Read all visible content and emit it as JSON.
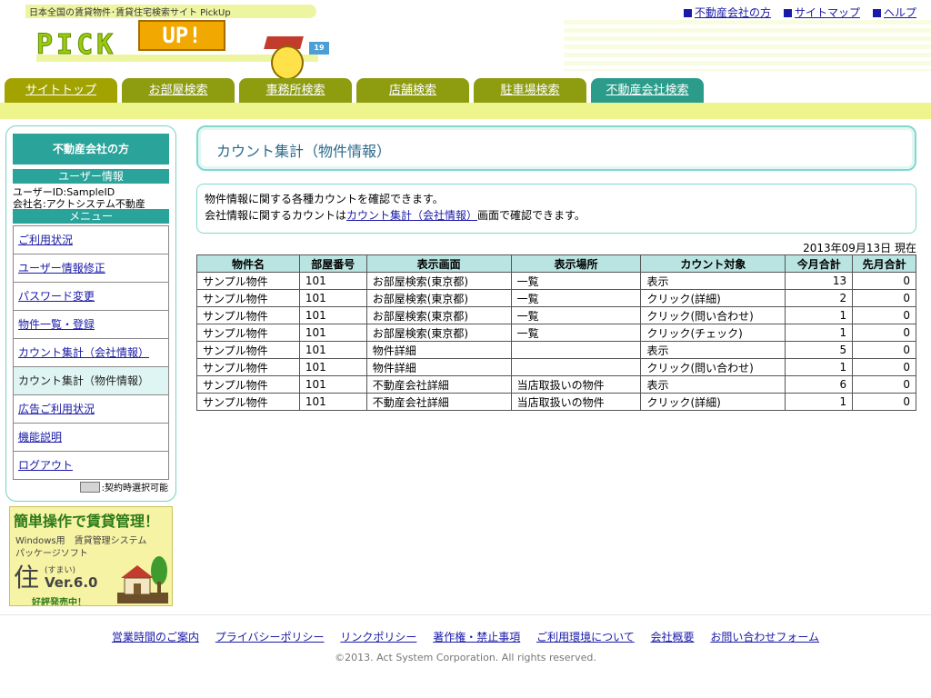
{
  "header": {
    "tagline": "日本全国の賃貸物件･賃貸住宅検索サイト PickUp",
    "logo_main": "PICK",
    "logo_up": "UP!",
    "mascot_badge": "19",
    "links": [
      "不動産会社の方",
      "サイトマップ",
      "ヘルプ"
    ]
  },
  "tabs": [
    "サイトトップ",
    "お部屋検索",
    "事務所検索",
    "店舗検索",
    "駐車場検索",
    "不動産会社検索"
  ],
  "sidebar": {
    "title": "不動産会社の方",
    "user_section": "ユーザー情報",
    "user_id": "ユーザーID:SampleID",
    "company": "会社名:アクトシステム不動産",
    "menu_section": "メニュー",
    "menu": [
      "ご利用状況",
      "ユーザー情報修正",
      "パスワード変更",
      "物件一覧・登録",
      "カウント集計（会社情報）",
      "カウント集計（物件情報）",
      "広告ご利用状況",
      "機能説明",
      "ログアウト"
    ],
    "legend": ":契約時選択可能"
  },
  "banner": {
    "headline": "簡単操作で賃貸管理！",
    "line1": "Windows用　賃貸管理システム",
    "line2": "パッケージソフト",
    "kanji": "住",
    "ruby": "(すまい)",
    "version": "Ver.6.0",
    "sale": "好評発売中！"
  },
  "main": {
    "title": "カウント集計（物件情報）",
    "desc_line1": "物件情報に関する各種カウントを確認できます。",
    "desc_line2_pre": "会社情報に関するカウントは",
    "desc_link": "カウント集計（会社情報）",
    "desc_line2_post": "画面で確認できます。",
    "date": "2013年09月13日 現在"
  },
  "table": {
    "headers": [
      "物件名",
      "部屋番号",
      "表示画面",
      "表示場所",
      "カウント対象",
      "今月合計",
      "先月合計"
    ],
    "rows": [
      [
        "サンプル物件",
        "101",
        "お部屋検索(東京都)",
        "一覧",
        "表示",
        "13",
        "0"
      ],
      [
        "サンプル物件",
        "101",
        "お部屋検索(東京都)",
        "一覧",
        "クリック(詳細)",
        "2",
        "0"
      ],
      [
        "サンプル物件",
        "101",
        "お部屋検索(東京都)",
        "一覧",
        "クリック(問い合わせ)",
        "1",
        "0"
      ],
      [
        "サンプル物件",
        "101",
        "お部屋検索(東京都)",
        "一覧",
        "クリック(チェック)",
        "1",
        "0"
      ],
      [
        "サンプル物件",
        "101",
        "物件詳細",
        "",
        "表示",
        "5",
        "0"
      ],
      [
        "サンプル物件",
        "101",
        "物件詳細",
        "",
        "クリック(問い合わせ)",
        "1",
        "0"
      ],
      [
        "サンプル物件",
        "101",
        "不動産会社詳細",
        "当店取扱いの物件",
        "表示",
        "6",
        "0"
      ],
      [
        "サンプル物件",
        "101",
        "不動産会社詳細",
        "当店取扱いの物件",
        "クリック(詳細)",
        "1",
        "0"
      ]
    ]
  },
  "footer": {
    "links": [
      "営業時間のご案内",
      "プライバシーポリシー",
      "リンクポリシー",
      "著作権・禁止事項",
      "ご利用環境について",
      "会社概要",
      "お問い合わせフォーム"
    ],
    "copyright": "©2013. Act System Corporation. All rights reserved."
  },
  "colors": {
    "accent_teal": "#2aa39a",
    "tab_olive": "#a2a300",
    "tab_active": "#2b9c8a",
    "table_header": "#b9e4e1",
    "link": "#1a1aa8"
  }
}
